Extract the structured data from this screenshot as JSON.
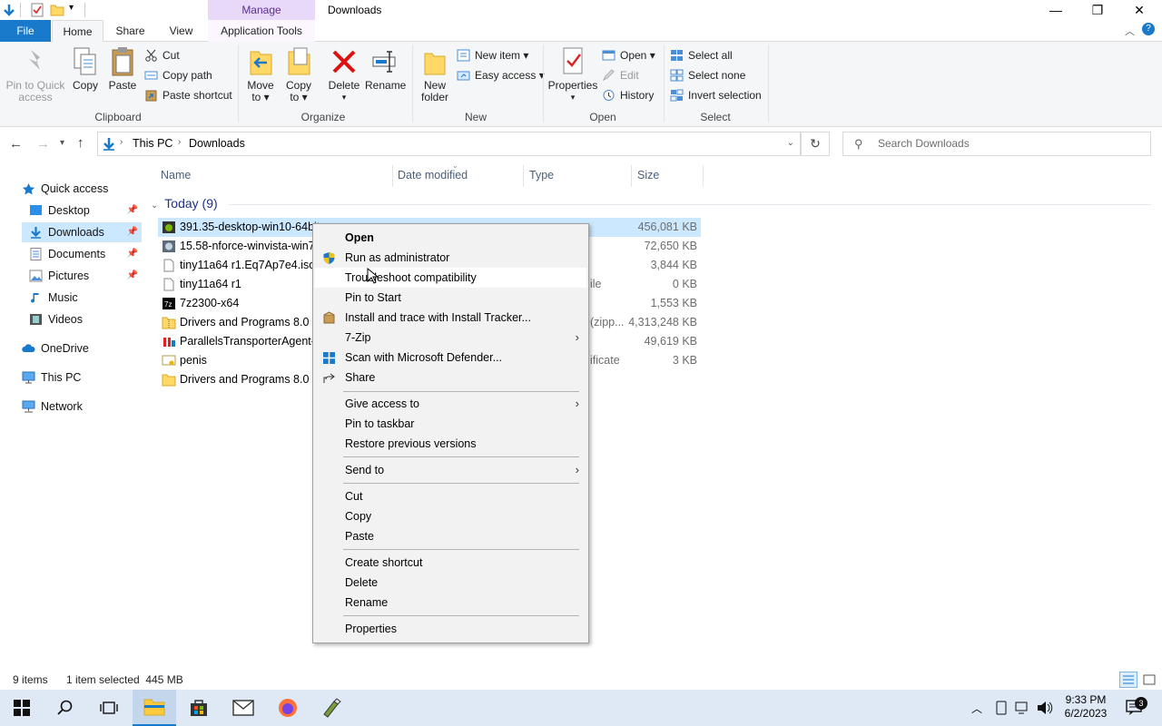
{
  "window": {
    "title": "Downloads",
    "manage_tab": "Manage",
    "minimize": "—",
    "maximize": "❐",
    "close": "✕"
  },
  "ribbon_tabs": {
    "file": "File",
    "home": "Home",
    "share": "Share",
    "view": "View",
    "app_tools": "Application Tools"
  },
  "ribbon": {
    "clipboard": {
      "pin": "Pin to Quick access",
      "pin_l1": "Pin to Quick",
      "pin_l2": "access",
      "copy": "Copy",
      "paste": "Paste",
      "cut": "Cut",
      "copy_path": "Copy path",
      "paste_shortcut": "Paste shortcut",
      "label": "Clipboard"
    },
    "organize": {
      "move_to_l1": "Move",
      "move_to_l2": "to ▾",
      "copy_to_l1": "Copy",
      "copy_to_l2": "to ▾",
      "delete": "Delete",
      "rename": "Rename",
      "label": "Organize"
    },
    "new": {
      "new_folder_l1": "New",
      "new_folder_l2": "folder",
      "new_item": "New item ▾",
      "easy_access": "Easy access ▾",
      "label": "New"
    },
    "open": {
      "properties": "Properties",
      "open": "Open ▾",
      "edit": "Edit",
      "history": "History",
      "label": "Open"
    },
    "select": {
      "select_all": "Select all",
      "select_none": "Select none",
      "invert": "Invert selection",
      "label": "Select"
    }
  },
  "address": {
    "crumbs": [
      "This PC",
      "Downloads"
    ],
    "search_placeholder": "Search Downloads"
  },
  "nav_pane": [
    {
      "label": "Quick access",
      "icon": "star-icon"
    },
    {
      "label": "Desktop",
      "icon": "desktop-icon",
      "pinned": true
    },
    {
      "label": "Downloads",
      "icon": "download-icon",
      "pinned": true,
      "selected": true
    },
    {
      "label": "Documents",
      "icon": "document-icon",
      "pinned": true
    },
    {
      "label": "Pictures",
      "icon": "pictures-icon",
      "pinned": true
    },
    {
      "label": "Music",
      "icon": "music-icon"
    },
    {
      "label": "Videos",
      "icon": "videos-icon"
    },
    {
      "label": "OneDrive",
      "icon": "cloud-icon"
    },
    {
      "label": "This PC",
      "icon": "computer-icon"
    },
    {
      "label": "Network",
      "icon": "network-icon"
    }
  ],
  "columns": {
    "name": "Name",
    "date": "Date modified",
    "type": "Type",
    "size": "Size"
  },
  "group": "Today (9)",
  "files": [
    {
      "name": "391.35-desktop-win10-64bit",
      "type": "",
      "size": "456,081 KB",
      "selected": true
    },
    {
      "name": "15.58-nforce-winvista-win7-",
      "type": "",
      "size": "72,650 KB"
    },
    {
      "name": "tiny11a64 r1.Eq7Ap7e4.iso.p",
      "type": "",
      "size": "3,844 KB"
    },
    {
      "name": "tiny11a64 r1",
      "type": "ile",
      "size": "0 KB"
    },
    {
      "name": "7z2300-x64",
      "type": "",
      "size": "1,553 KB"
    },
    {
      "name": "Drivers and Programs 8.0",
      "type": "(zipp...",
      "size": "4,313,248 KB"
    },
    {
      "name": "ParallelsTransporterAgent-1",
      "type": "",
      "size": "49,619 KB"
    },
    {
      "name": "penis",
      "type": "ificate",
      "size": "3 KB"
    },
    {
      "name": "Drivers and Programs 8.0",
      "type": "",
      "size": ""
    }
  ],
  "context_menu": {
    "open": "Open",
    "run_admin": "Run as administrator",
    "troubleshoot": "Troubleshoot compatibility",
    "pin_start": "Pin to Start",
    "install_trace": "Install and trace with Install Tracker...",
    "zip": "7-Zip",
    "scan": "Scan with Microsoft Defender...",
    "share": "Share",
    "give_access": "Give access to",
    "pin_taskbar": "Pin to taskbar",
    "restore": "Restore previous versions",
    "send_to": "Send to",
    "cut": "Cut",
    "copy": "Copy",
    "paste": "Paste",
    "create_shortcut": "Create shortcut",
    "delete": "Delete",
    "rename": "Rename",
    "properties": "Properties"
  },
  "status": {
    "items": "9 items",
    "selected": "1 item selected  445 MB"
  },
  "taskbar": {
    "time": "9:33 PM",
    "date": "6/2/2023"
  },
  "colors": {
    "accent": "#1979ca",
    "selection": "#cce8ff",
    "manage": "#e7d9f7",
    "taskbar": "#dfe9f5"
  }
}
